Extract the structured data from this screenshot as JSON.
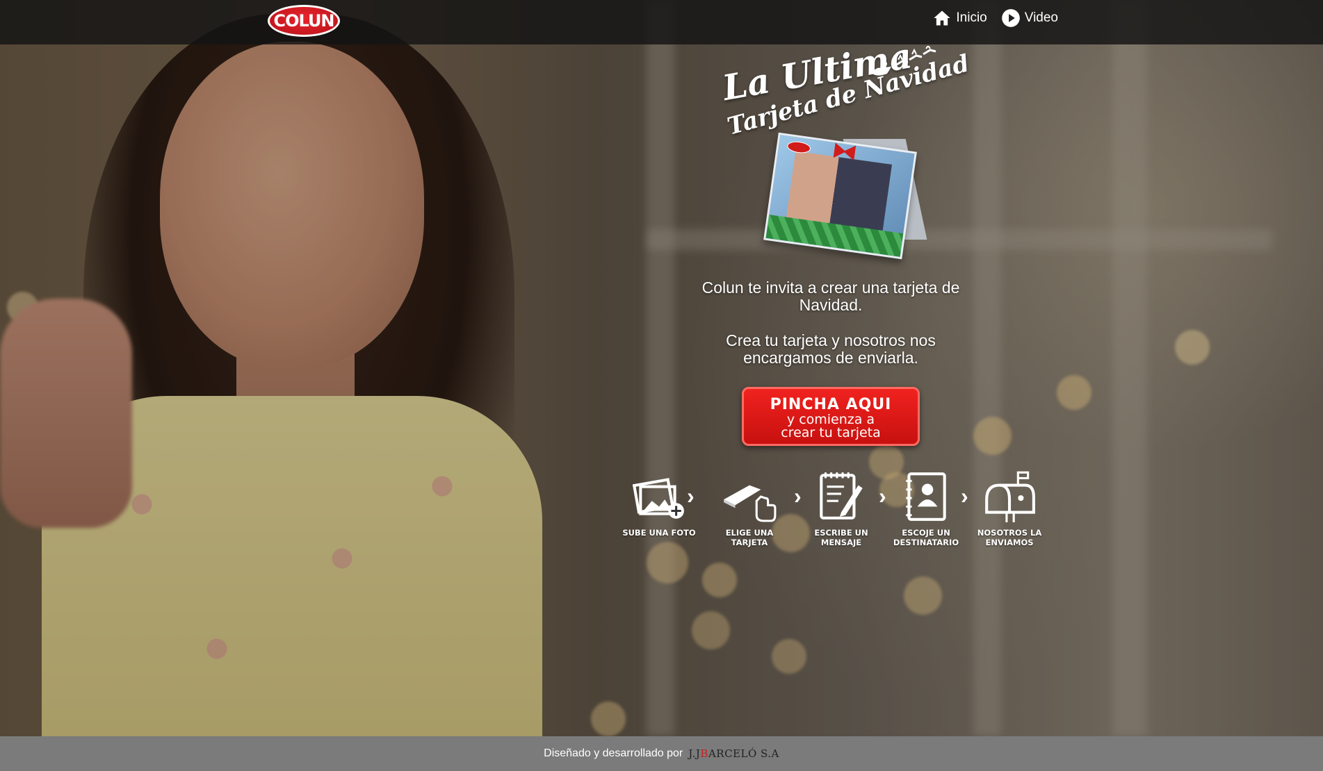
{
  "brand": {
    "logo_text": "COLUN",
    "accent_color": "#e11b1b"
  },
  "nav": {
    "items": [
      {
        "label": "Inicio",
        "icon": "home-icon"
      },
      {
        "label": "Video",
        "icon": "play-icon"
      }
    ]
  },
  "hero": {
    "title_line1": "La Ultima",
    "title_line2": "Tarjeta de Navidad",
    "card_logo": "COLUN"
  },
  "intro": {
    "paragraph1": "Colun te invita a crear una tarjeta de Navidad.",
    "paragraph2": "Crea tu tarjeta y nosotros nos encargamos de enviarla."
  },
  "cta": {
    "main": "PINCHA AQUI",
    "sub1": "y comienza a",
    "sub2": "crear tu tarjeta"
  },
  "steps": [
    {
      "label": "SUBE UNA FOTO",
      "icon": "photo-add-icon"
    },
    {
      "label": "ELIGE UNA TARJETA",
      "icon": "card-pointer-icon"
    },
    {
      "label": "ESCRIBE UN MENSAJE",
      "icon": "notepad-pencil-icon"
    },
    {
      "label": "ESCOJE UN DESTINATARIO",
      "icon": "contact-book-icon"
    },
    {
      "label": "NOSOTROS LA ENVIAMOS",
      "icon": "mailbox-icon"
    }
  ],
  "footer": {
    "text": "Diseñado y desarrollado por",
    "brand_prefix": "J.J",
    "brand_initial": "B",
    "brand_rest": "ARCELÓ S.A"
  }
}
